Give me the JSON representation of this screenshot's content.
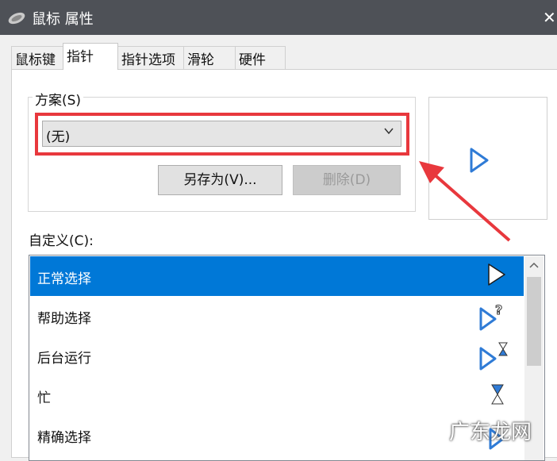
{
  "window": {
    "title": "鼠标 属性",
    "close_icon": "close-icon",
    "app_icon": "mouse-icon"
  },
  "tabs": [
    {
      "label": "鼠标键",
      "active": false
    },
    {
      "label": "指针",
      "active": true
    },
    {
      "label": "指针选项",
      "active": false
    },
    {
      "label": "滑轮",
      "active": false
    },
    {
      "label": "硬件",
      "active": false
    }
  ],
  "scheme": {
    "group_label": "方案(S)",
    "selected": "(无)",
    "save_as_label": "另存为(V)...",
    "delete_label": "删除(D)",
    "highlight_color": "#e8383d"
  },
  "custom": {
    "label": "自定义(C):",
    "items": [
      {
        "label": "正常选择",
        "cursor": "arrow-cursor-icon",
        "selected": true
      },
      {
        "label": "帮助选择",
        "cursor": "help-cursor-icon",
        "selected": false
      },
      {
        "label": "后台运行",
        "cursor": "working-cursor-icon",
        "selected": false
      },
      {
        "label": "忙",
        "cursor": "busy-cursor-icon",
        "selected": false
      },
      {
        "label": "精确选择",
        "cursor": "precision-cursor-icon",
        "selected": false
      }
    ]
  },
  "colors": {
    "selection": "#0078d7",
    "titlebar": "#4e5157",
    "cursor_blue": "#2f7bd6"
  },
  "watermark": "广东龙网"
}
